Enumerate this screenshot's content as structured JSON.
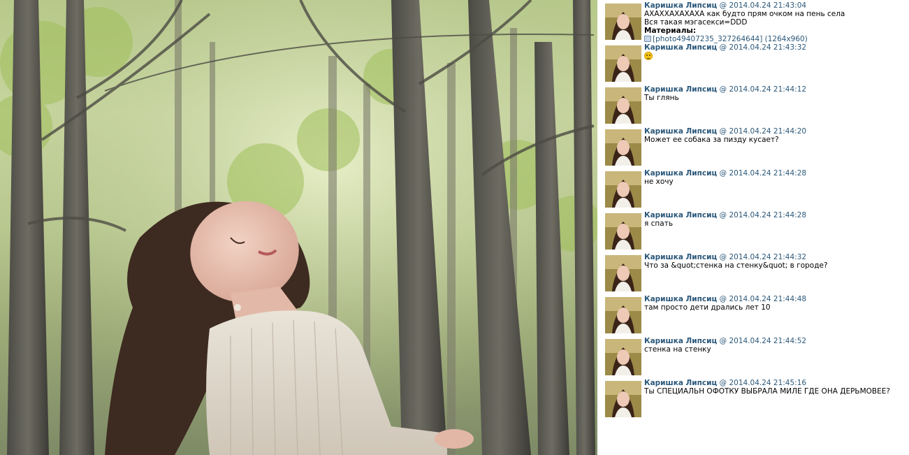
{
  "messages": [
    {
      "author": "Каришка Липсиц",
      "sep": "@",
      "time": "2014.04.24 21:43:04",
      "lines": [
        "АХАХХАХАХАХА как будто прям очком на пень села",
        "Вся такая мэгасекси=DDD"
      ],
      "materials_label": "Материалы:",
      "attachment": "[photo49407235_327264644] (1264x960)"
    },
    {
      "author": "Каришка Липсиц",
      "sep": "@",
      "time": "2014.04.24 21:43:32",
      "emoji": "smile-emoji"
    },
    {
      "author": "Каришка Липсиц",
      "sep": "@",
      "time": "2014.04.24 21:44:12",
      "lines": [
        "Ты глянь"
      ]
    },
    {
      "author": "Каришка Липсиц",
      "sep": "@",
      "time": "2014.04.24 21:44:20",
      "lines": [
        "Может ее собака за пизду кусает?"
      ]
    },
    {
      "author": "Каришка Липсиц",
      "sep": "@",
      "time": "2014.04.24 21:44:28",
      "lines": [
        "не хочу"
      ]
    },
    {
      "author": "Каришка Липсиц",
      "sep": "@",
      "time": "2014.04.24 21:44:28",
      "lines": [
        "я спать"
      ]
    },
    {
      "author": "Каришка Липсиц",
      "sep": "@",
      "time": "2014.04.24 21:44:32",
      "lines": [
        "Что за &quot;стенка на стенку&quot; в городе?"
      ]
    },
    {
      "author": "Каришка Липсиц",
      "sep": "@",
      "time": "2014.04.24 21:44:48",
      "lines": [
        "там просто дети дрались лет 10"
      ]
    },
    {
      "author": "Каришка Липсиц",
      "sep": "@",
      "time": "2014.04.24 21:44:52",
      "lines": [
        "стенка на стенку"
      ]
    },
    {
      "author": "Каришка Липсиц",
      "sep": "@",
      "time": "2014.04.24 21:45:16",
      "lines": [
        "Ты СПЕЦИАЛЬН ОФОТКУ ВЫБРАЛА МИЛЕ ГДЕ ОНА ДЕРЬМОВЕЕ?"
      ]
    }
  ],
  "colors": {
    "link": "#2b587a",
    "text": "#000000"
  }
}
